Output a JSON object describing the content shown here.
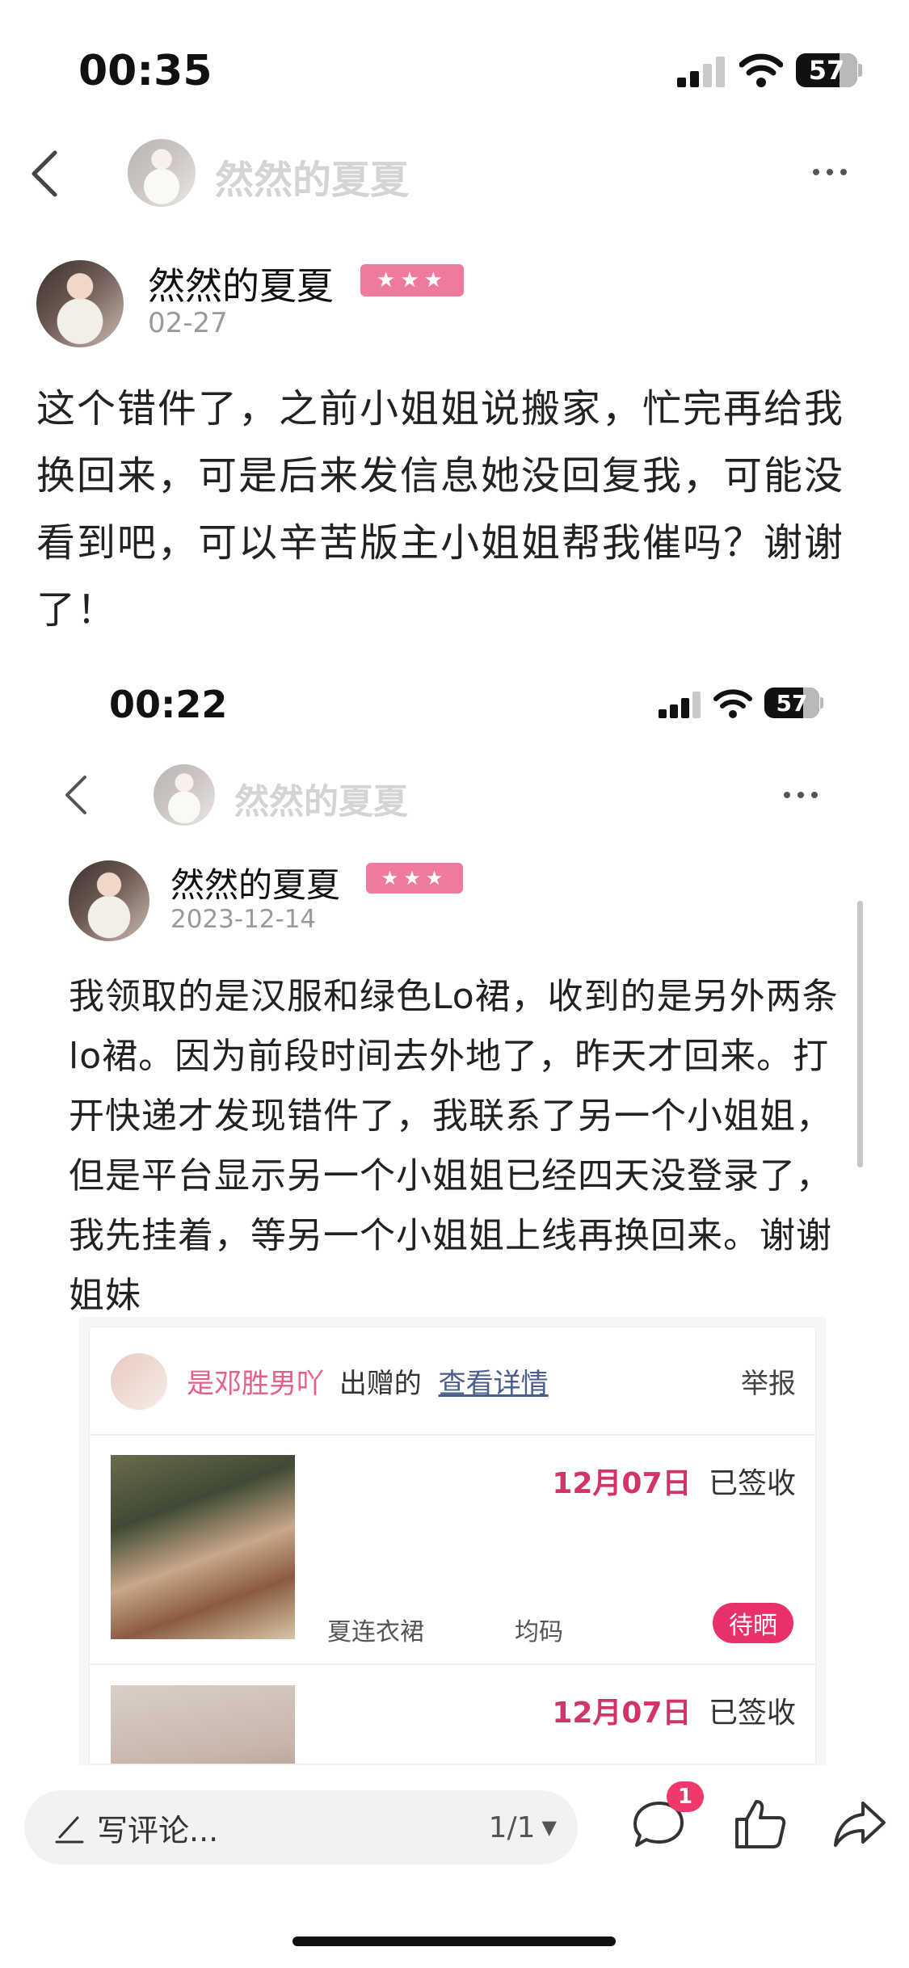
{
  "status_bar": {
    "time": "00:35",
    "battery": "57"
  },
  "header": {
    "title": "然然的夏夏"
  },
  "post": {
    "author": "然然的夏夏",
    "rating": "★★★",
    "date": "02-27",
    "text": "这个错件了，之前小姐姐说搬家，忙完再给我换回来，可是后来发信息她没回复我，可能没看到吧，可以辛苦版主小姐姐帮我催吗？谢谢了！"
  },
  "screenshot": {
    "status_bar": {
      "time": "00:22",
      "battery": "57"
    },
    "header": {
      "title": "然然的夏夏"
    },
    "post": {
      "author": "然然的夏夏",
      "rating": "★★★",
      "date": "2023-12-14",
      "text": "我领取的是汉服和绿色Lo裙，收到的是另外两条lo裙。因为前段时间去外地了，昨天才回来。打开快递才发现错件了，我联系了另一个小姐姐，但是平台显示另一个小姐姐已经四天没登录了，我先挂着，等另一个小姐姐上线再换回来。谢谢姐妹"
    },
    "order_card": {
      "giver": "是邓胜男吖",
      "given_label": "出赠的",
      "details_link": "查看详情",
      "report": "举报",
      "items": [
        {
          "date": "12月07日",
          "status": "已签收",
          "name": "夏连衣裙",
          "size": "均码",
          "badge": "待晒"
        },
        {
          "date": "12月07日",
          "status": "已签收"
        }
      ]
    }
  },
  "bottom_bar": {
    "comment_placeholder": "写评论...",
    "page_indicator": "1/1",
    "comment_count_badge": "1"
  }
}
